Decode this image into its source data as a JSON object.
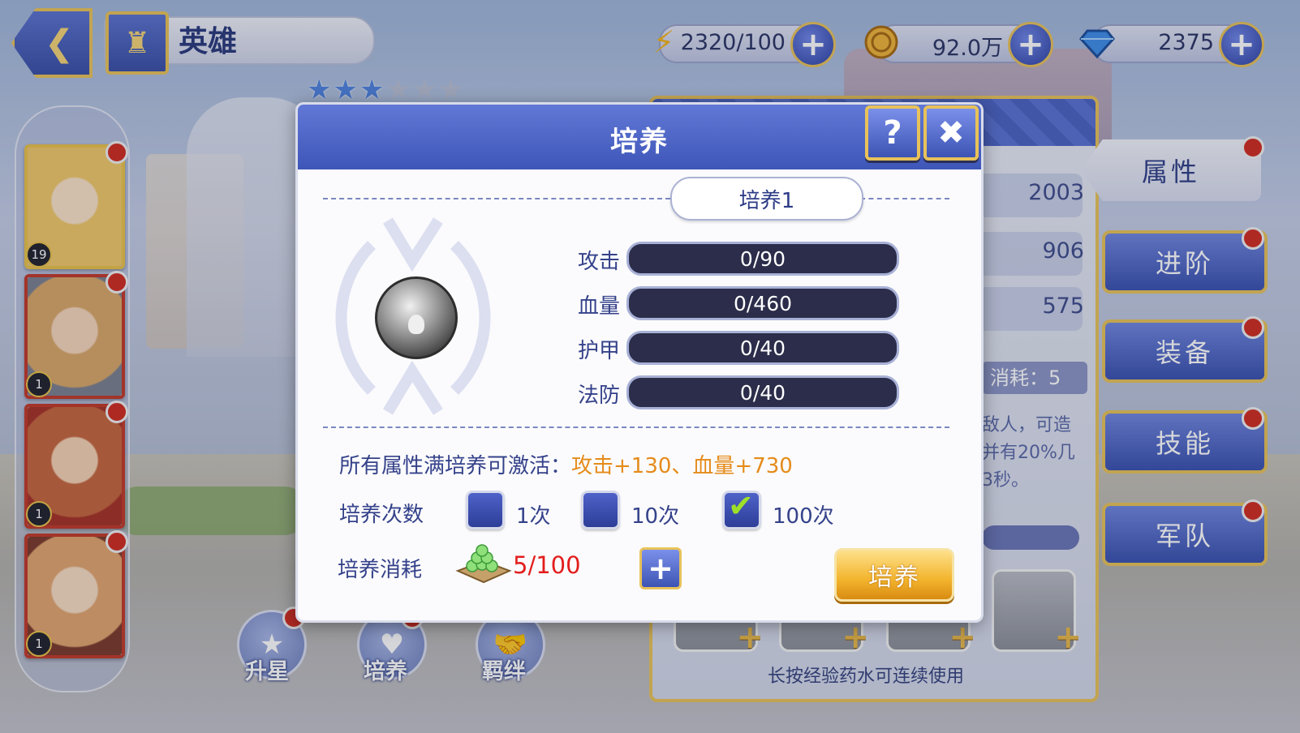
{
  "header": {
    "title": "英雄",
    "back_icon": "back-arrow-icon",
    "castle_icon": "castle-icon"
  },
  "resources": {
    "energy": {
      "value": "2320/100",
      "icon": "lightning-icon"
    },
    "gold": {
      "value": "92.0万",
      "icon": "coin-icon"
    },
    "gems": {
      "value": "2375",
      "icon": "diamond-icon"
    }
  },
  "hero": {
    "stars_total": 6,
    "stars_filled": 3
  },
  "hero_list": [
    {
      "level": "19",
      "selected": true,
      "color": "#f1c86a"
    },
    {
      "level": "1",
      "selected": false,
      "color": "#d9a868"
    },
    {
      "level": "1",
      "selected": false,
      "color": "#c6663d"
    },
    {
      "level": "1",
      "selected": false,
      "color": "#e2a56e"
    }
  ],
  "right_panel": {
    "stats": [
      "2003",
      "906",
      "575"
    ],
    "cost_text": "消耗：5",
    "desc_lines": [
      "敌人，可造",
      "并有20%几",
      "3秒。"
    ],
    "hint": "长按经验药水可连续使用"
  },
  "right_tabs": [
    "属性",
    "进阶",
    "装备",
    "技能",
    "军队"
  ],
  "bottom_buttons": [
    "升星",
    "培养",
    "羁绊"
  ],
  "modal": {
    "title": "培养",
    "sub_tab": "培养1",
    "stats": [
      {
        "label": "攻击",
        "value": "0/90"
      },
      {
        "label": "血量",
        "value": "0/460"
      },
      {
        "label": "护甲",
        "value": "0/40"
      },
      {
        "label": "法防",
        "value": "0/40"
      }
    ],
    "bonus_prefix": "所有属性满培养可激活：",
    "bonus_value": "攻击+130、血量+730",
    "times_label": "培养次数",
    "times_options": [
      {
        "label": "1次",
        "checked": false
      },
      {
        "label": "10次",
        "checked": false
      },
      {
        "label": "100次",
        "checked": true
      }
    ],
    "cost_label": "培养消耗",
    "cost_value": "5/100",
    "train_button": "培养"
  },
  "colors": {
    "accent": "#4a60c0",
    "gold": "#e8c25a",
    "highlight": "#e58b1a",
    "cost": "#e31d1d"
  }
}
